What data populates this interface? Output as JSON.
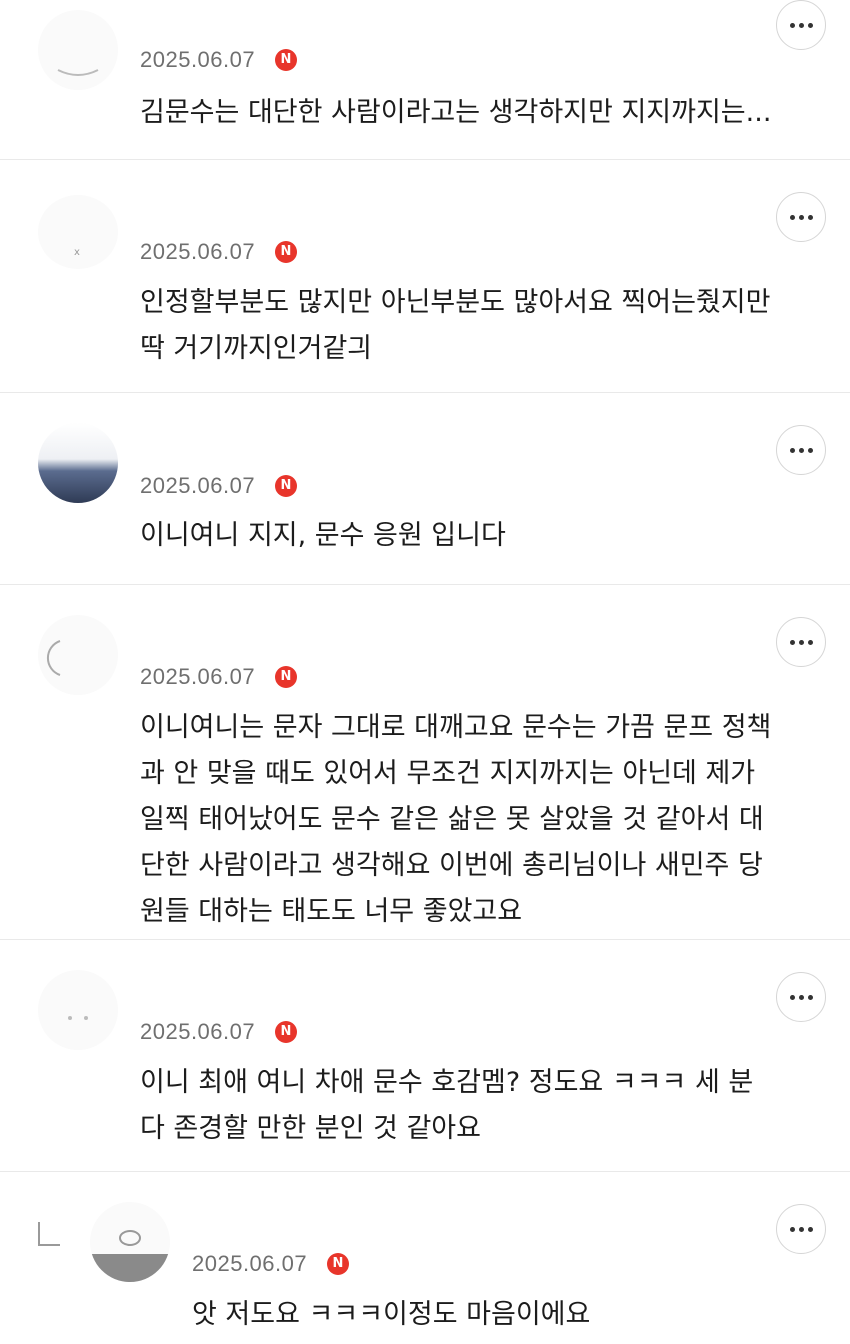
{
  "comments": [
    {
      "date": "2025.06.07",
      "badge": "N",
      "text": "김문수는 대단한 사람이라고는 생각하지만 지지까지는..."
    },
    {
      "date": "2025.06.07",
      "badge": "N",
      "text": "인정할부분도 많지만 아닌부분도 많아서요 찍어는줬지만\n딱 거기까지인거같긔"
    },
    {
      "date": "2025.06.07",
      "badge": "N",
      "text": "이니여니 지지, 문수 응원 입니다"
    },
    {
      "date": "2025.06.07",
      "badge": "N",
      "text": "이니여니는 문자 그대로 대깨고요 문수는 가끔 문프 정책\n과 안 맞을 때도 있어서 무조건 지지까지는 아닌데 제가\n일찍 태어났어도 문수 같은 삶은 못 살았을 것 같아서 대\n단한 사람이라고 생각해요 이번에 총리님이나 새민주 당\n원들 대하는 태도도 너무 좋았고요"
    },
    {
      "date": "2025.06.07",
      "badge": "N",
      "text": "이니 최애 여니 차애 문수 호감멤? 정도요 ㅋㅋㅋ 세 분\n다 존경할 만한 분인 것 같아요"
    }
  ],
  "reply": {
    "date": "2025.06.07",
    "badge": "N",
    "text": "앗 저도요 ㅋㅋㅋ이정도 마음이에요"
  },
  "icons": {
    "more": "more-dots-icon",
    "badge": "new-badge-icon",
    "reply": "reply-arrow-icon"
  },
  "colors": {
    "badge": "#e8352b",
    "date": "#6f6f6f",
    "divider": "#e9e9e9"
  }
}
